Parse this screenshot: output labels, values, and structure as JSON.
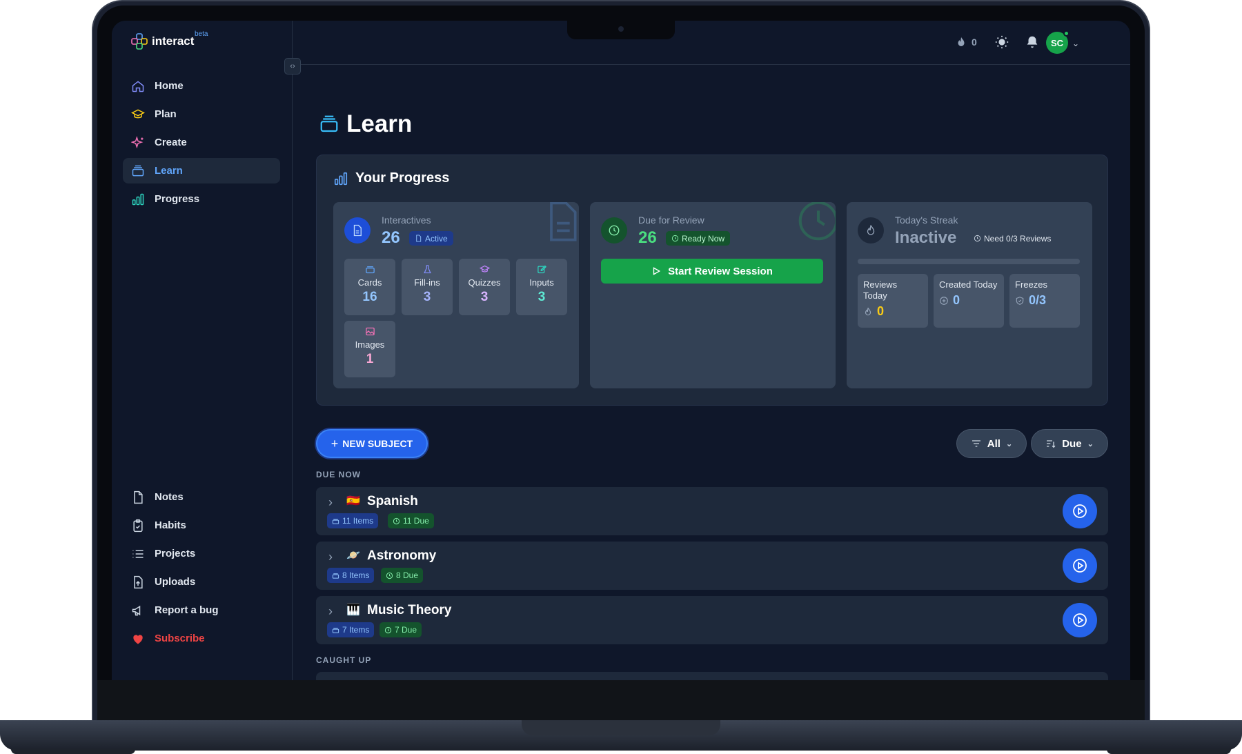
{
  "app": {
    "name": "interact",
    "badge": "beta"
  },
  "sidebar": {
    "top_items": [
      {
        "label": "Home"
      },
      {
        "label": "Plan"
      },
      {
        "label": "Create"
      },
      {
        "label": "Learn"
      },
      {
        "label": "Progress"
      }
    ],
    "bottom_items": [
      {
        "label": "Notes"
      },
      {
        "label": "Habits"
      },
      {
        "label": "Projects"
      },
      {
        "label": "Uploads"
      },
      {
        "label": "Report a bug"
      },
      {
        "label": "Subscribe"
      }
    ],
    "active": "Learn"
  },
  "topbar": {
    "streak_count": "0",
    "avatar_initials": "SC"
  },
  "page": {
    "title": "Learn"
  },
  "progress": {
    "title": "Your Progress",
    "interactives": {
      "label": "Interactives",
      "value": "26",
      "status": "Active",
      "types": [
        {
          "label": "Cards",
          "value": "16",
          "color": "#93c5fd"
        },
        {
          "label": "Fill-ins",
          "value": "3",
          "color": "#a5b4fc"
        },
        {
          "label": "Quizzes",
          "value": "3",
          "color": "#d8b4fe"
        },
        {
          "label": "Inputs",
          "value": "3",
          "color": "#5eead4"
        },
        {
          "label": "Images",
          "value": "1",
          "color": "#f9a8d4"
        }
      ]
    },
    "review": {
      "label": "Due for Review",
      "value": "26",
      "status": "Ready Now",
      "button": "Start Review Session"
    },
    "streak": {
      "label": "Today's Streak",
      "value": "Inactive",
      "note": "Need 0/3 Reviews",
      "stats": [
        {
          "label": "Reviews Today",
          "value": "0"
        },
        {
          "label": "Created Today",
          "value": "0"
        },
        {
          "label": "Freezes",
          "value": "0/3"
        }
      ]
    }
  },
  "toolbar": {
    "new_subject": "NEW SUBJECT",
    "filter": "All",
    "sort": "Due"
  },
  "sections": {
    "due_now": "DUE NOW",
    "caught_up": "CAUGHT UP"
  },
  "subjects": [
    {
      "name": "Spanish",
      "emoji": "🇪🇸",
      "items": "11 Items",
      "due": "11 Due"
    },
    {
      "name": "Astronomy",
      "emoji": "🪐",
      "items": "8 Items",
      "due": "8 Due"
    },
    {
      "name": "Music Theory",
      "emoji": "🎹",
      "items": "7 Items",
      "due": "7 Due"
    }
  ],
  "colors": {
    "accent": "#2563eb",
    "success": "#16a34a",
    "background": "#0f172a",
    "surface": "#1e293b"
  }
}
